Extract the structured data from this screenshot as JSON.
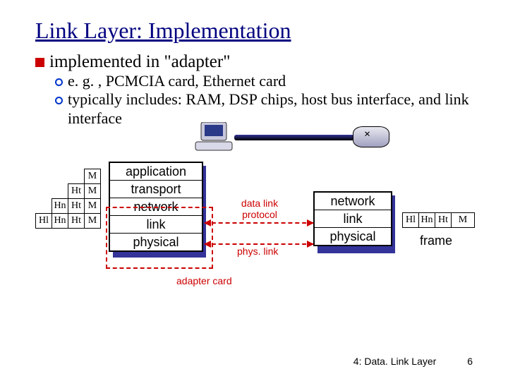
{
  "title": "Link Layer: Implementation",
  "bullets": {
    "main": "implemented in \"adapter\"",
    "sub1": "e. g. , PCMCIA card, Ethernet card",
    "sub2": "typically includes: RAM, DSP chips, host bus interface, and link interface"
  },
  "leftStack": {
    "rows": [
      "application",
      "transport",
      "network",
      "link",
      "physical"
    ]
  },
  "rightStack": {
    "rows": [
      "network",
      "link",
      "physical"
    ]
  },
  "headersLeft": {
    "r1": {
      "c4": "M"
    },
    "r2": {
      "c3": "Ht",
      "c4": "M"
    },
    "r3": {
      "c2": "Hn",
      "c3": "Ht",
      "c4": "M"
    },
    "r4": {
      "c1": "Hl",
      "c2": "Hn",
      "c3": "Ht",
      "c4": "M"
    }
  },
  "headersRight": {
    "c1": "Hl",
    "c2": "Hn",
    "c3": "Ht",
    "c4": "M"
  },
  "labels": {
    "datalink": "data link\nprotocol",
    "physlink": "phys. link",
    "adapter": "adapter card",
    "frame": "frame"
  },
  "footer": {
    "section": "4: Data. Link Layer",
    "page": "6"
  }
}
